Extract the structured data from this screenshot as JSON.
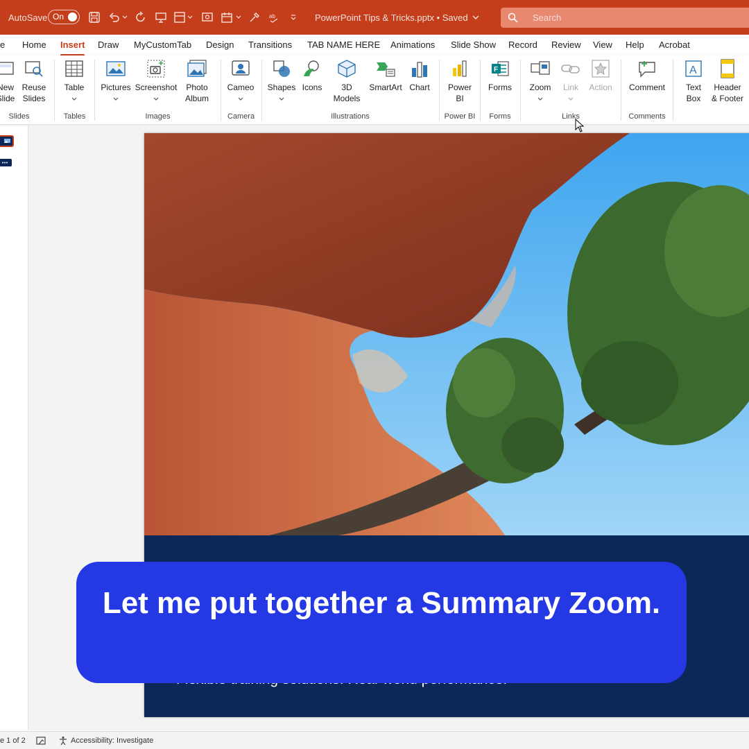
{
  "titlebar": {
    "autosave_label": "AutoSave",
    "autosave_state": "On",
    "document_title": "PowerPoint Tips & Tricks.pptx • Saved",
    "search_placeholder": "Search",
    "accent_color": "#c43e1c"
  },
  "tabs": [
    {
      "label": "e"
    },
    {
      "label": "Home"
    },
    {
      "label": "Insert",
      "active": true
    },
    {
      "label": "Draw"
    },
    {
      "label": "MyCustomTab"
    },
    {
      "label": "Design"
    },
    {
      "label": "Transitions"
    },
    {
      "label": "TAB NAME HERE"
    },
    {
      "label": "Animations"
    },
    {
      "label": "Slide Show"
    },
    {
      "label": "Record"
    },
    {
      "label": "Review"
    },
    {
      "label": "View"
    },
    {
      "label": "Help"
    },
    {
      "label": "Acrobat"
    }
  ],
  "ribbon": {
    "buttons": {
      "new_slide": "New\nSlide",
      "reuse_slides": "Reuse\nSlides",
      "table": "Table",
      "pictures": "Pictures",
      "screenshot": "Screenshot",
      "photo_album": "Photo\nAlbum",
      "cameo": "Cameo",
      "shapes": "Shapes",
      "icons": "Icons",
      "models_3d": "3D\nModels",
      "smartart": "SmartArt",
      "chart": "Chart",
      "power_bi": "Power\nBI",
      "forms": "Forms",
      "zoom": "Zoom",
      "link": "Link",
      "action": "Action",
      "comment": "Comment",
      "text_box": "Text\nBox",
      "header_footer": "Header\n& Footer"
    },
    "groups": {
      "slides": "Slides",
      "tables": "Tables",
      "images": "Images",
      "camera": "Camera",
      "illustrations": "Illustrations",
      "power_bi": "Power BI",
      "forms": "Forms",
      "links": "Links",
      "comments": "Comments"
    }
  },
  "slide": {
    "subtitle": "Flexible training solutions. Real-world performance."
  },
  "caption": {
    "text": "Let me put together a Summary Zoom."
  },
  "statusbar": {
    "slide_counter": "e 1 of 2",
    "accessibility": "Accessibility: Investigate"
  }
}
